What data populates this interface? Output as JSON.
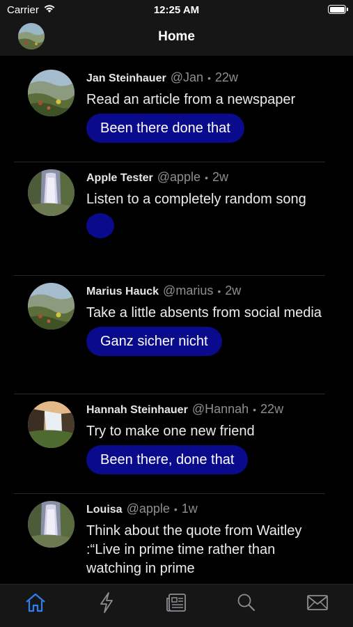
{
  "status": {
    "carrier": "Carrier",
    "time": "12:25 AM"
  },
  "nav": {
    "title": "Home"
  },
  "posts": [
    {
      "name": "Jan Steinhauer",
      "handle": "@Jan",
      "time": "22w",
      "text": "Read an article from a newspaper",
      "button": "Been there done that",
      "avatar": "meadow-photo"
    },
    {
      "name": "Apple Tester",
      "handle": "@apple",
      "time": "2w",
      "text": "Listen to a completely random song",
      "button": "",
      "avatar": "waterfall-photo"
    },
    {
      "name": "Marius Hauck",
      "handle": "@marius",
      "time": "2w",
      "text": "Take a little absents from social media",
      "button": "Ganz sicher nicht",
      "avatar": "meadow-photo"
    },
    {
      "name": "Hannah Steinhauer",
      "handle": "@Hannah",
      "time": "22w",
      "text": "Try to make one new friend",
      "button": "Been there, done that",
      "avatar": "waterfall-sunset-photo"
    },
    {
      "name": "Louisa",
      "handle": "@apple",
      "time": "1w",
      "text": "Think about the quote from Waitley :“Live in prime time rather than watching in prime",
      "button": "",
      "avatar": "waterfall-photo"
    }
  ],
  "tabs": [
    {
      "icon": "home-icon",
      "active": true
    },
    {
      "icon": "lightning-icon",
      "active": false
    },
    {
      "icon": "newspaper-icon",
      "active": false
    },
    {
      "icon": "search-icon",
      "active": false
    },
    {
      "icon": "mail-icon",
      "active": false
    }
  ],
  "colors": {
    "accent": "#0a0a8c",
    "tab_active": "#2f7ff0",
    "tab_inactive": "#8e8e93"
  }
}
